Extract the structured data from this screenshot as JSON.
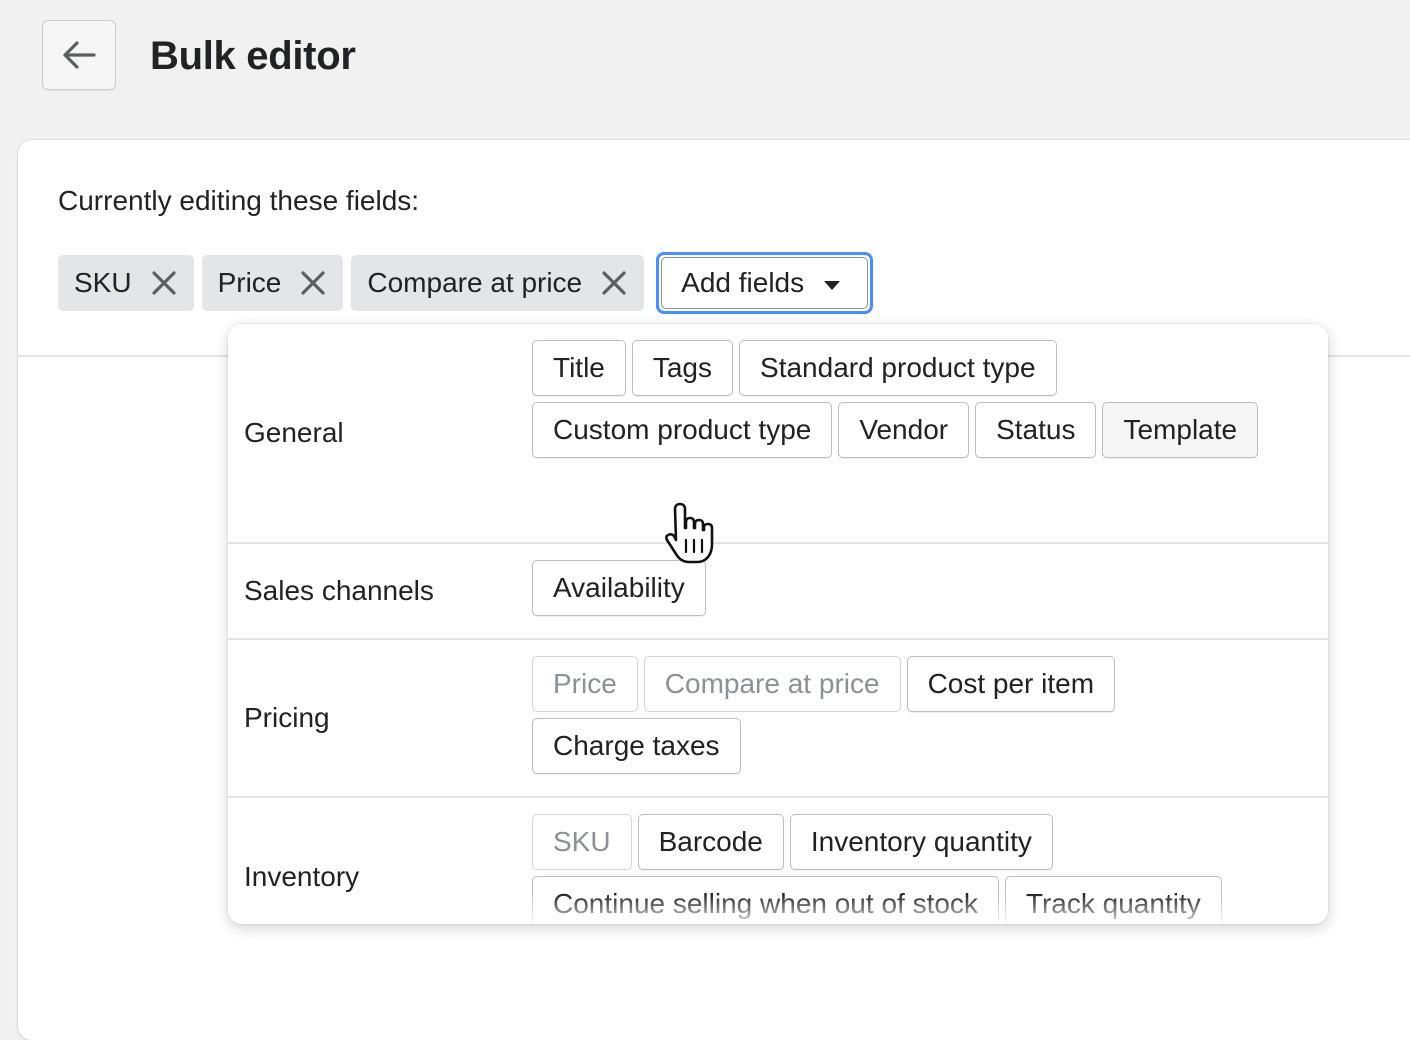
{
  "header": {
    "back_icon": "arrow-left-icon",
    "title": "Bulk editor"
  },
  "editing": {
    "label": "Currently editing these fields:",
    "chips": [
      {
        "label": "SKU"
      },
      {
        "label": "Price"
      },
      {
        "label": "Compare at price"
      }
    ],
    "remove_icon": "close-icon",
    "add_fields_label": "Add fields",
    "add_fields_icon": "caret-down-icon"
  },
  "popover": {
    "sections": {
      "general": {
        "label": "General",
        "fields": [
          {
            "label": "Title",
            "disabled": false
          },
          {
            "label": "Tags",
            "disabled": false
          },
          {
            "label": "Standard product type",
            "disabled": false
          },
          {
            "label": "Custom product type",
            "disabled": false
          },
          {
            "label": "Vendor",
            "disabled": false
          },
          {
            "label": "Status",
            "disabled": false
          },
          {
            "label": "Template",
            "disabled": false
          }
        ]
      },
      "sales_channels": {
        "label": "Sales channels",
        "fields": [
          {
            "label": "Availability",
            "disabled": false
          }
        ]
      },
      "pricing": {
        "label": "Pricing",
        "fields": [
          {
            "label": "Price",
            "disabled": true
          },
          {
            "label": "Compare at price",
            "disabled": true
          },
          {
            "label": "Cost per item",
            "disabled": false
          },
          {
            "label": "Charge taxes",
            "disabled": false
          }
        ]
      },
      "inventory": {
        "label": "Inventory",
        "fields": [
          {
            "label": "SKU",
            "disabled": true
          },
          {
            "label": "Barcode",
            "disabled": false
          },
          {
            "label": "Inventory quantity",
            "disabled": false
          },
          {
            "label": "Continue selling when out of stock",
            "disabled": false
          },
          {
            "label": "Track quantity",
            "disabled": false
          }
        ]
      }
    }
  },
  "cursor_icon": "hand-pointer-icon",
  "colors": {
    "focus_ring": "#458fff",
    "chip_bg": "#e4e5e7",
    "disabled_text": "#8c9196"
  }
}
